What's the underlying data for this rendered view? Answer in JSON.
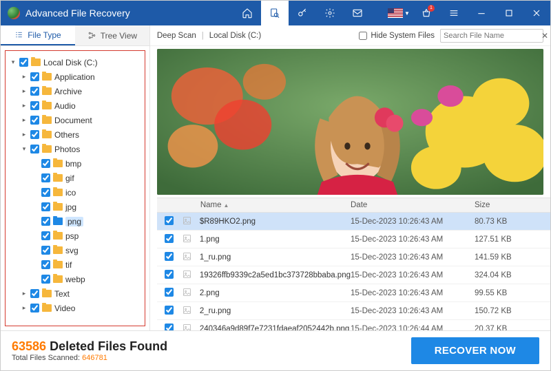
{
  "app": {
    "title": "Advanced File Recovery"
  },
  "titlebar": {
    "badge": "1"
  },
  "sidebar": {
    "tabs": {
      "file_type": "File Type",
      "tree_view": "Tree View"
    },
    "tree": [
      {
        "level": 0,
        "expander": "▾",
        "label": "Local Disk (C:)",
        "selected": false
      },
      {
        "level": 1,
        "expander": "▸",
        "label": "Application",
        "selected": false
      },
      {
        "level": 1,
        "expander": "▸",
        "label": "Archive",
        "selected": false
      },
      {
        "level": 1,
        "expander": "▸",
        "label": "Audio",
        "selected": false
      },
      {
        "level": 1,
        "expander": "▸",
        "label": "Document",
        "selected": false
      },
      {
        "level": 1,
        "expander": "▸",
        "label": "Others",
        "selected": false
      },
      {
        "level": 1,
        "expander": "▾",
        "label": "Photos",
        "selected": false
      },
      {
        "level": 2,
        "expander": "",
        "label": "bmp",
        "selected": false
      },
      {
        "level": 2,
        "expander": "",
        "label": "gif",
        "selected": false
      },
      {
        "level": 2,
        "expander": "",
        "label": "ico",
        "selected": false
      },
      {
        "level": 2,
        "expander": "",
        "label": "jpg",
        "selected": false
      },
      {
        "level": 2,
        "expander": "",
        "label": "png",
        "selected": true
      },
      {
        "level": 2,
        "expander": "",
        "label": "psp",
        "selected": false
      },
      {
        "level": 2,
        "expander": "",
        "label": "svg",
        "selected": false
      },
      {
        "level": 2,
        "expander": "",
        "label": "tif",
        "selected": false
      },
      {
        "level": 2,
        "expander": "",
        "label": "webp",
        "selected": false
      },
      {
        "level": 1,
        "expander": "▸",
        "label": "Text",
        "selected": false
      },
      {
        "level": 1,
        "expander": "▸",
        "label": "Video",
        "selected": false
      }
    ]
  },
  "toolbar": {
    "scan_mode": "Deep Scan",
    "location": "Local Disk (C:)",
    "hide_system": "Hide System Files",
    "search_placeholder": "Search File Name"
  },
  "grid": {
    "headers": {
      "name": "Name",
      "date": "Date",
      "size": "Size"
    },
    "rows": [
      {
        "name": "$R89HKO2.png",
        "date": "15-Dec-2023 10:26:43 AM",
        "size": "80.73 KB",
        "selected": true
      },
      {
        "name": "1.png",
        "date": "15-Dec-2023 10:26:43 AM",
        "size": "127.51 KB",
        "selected": false
      },
      {
        "name": "1_ru.png",
        "date": "15-Dec-2023 10:26:43 AM",
        "size": "141.59 KB",
        "selected": false
      },
      {
        "name": "19326ffb9339c2a5ed1bc373728bbaba.png",
        "date": "15-Dec-2023 10:26:43 AM",
        "size": "324.04 KB",
        "selected": false
      },
      {
        "name": "2.png",
        "date": "15-Dec-2023 10:26:43 AM",
        "size": "99.55 KB",
        "selected": false
      },
      {
        "name": "2_ru.png",
        "date": "15-Dec-2023 10:26:43 AM",
        "size": "150.72 KB",
        "selected": false
      },
      {
        "name": "240346a9d89f7e7231fdaeaf2052442b.png",
        "date": "15-Dec-2023 10:26:44 AM",
        "size": "20.37 KB",
        "selected": false
      }
    ]
  },
  "footer": {
    "deleted_count": "63586",
    "deleted_suffix": " Deleted Files Found",
    "scanned_label": "Total Files Scanned: ",
    "scanned_count": "646781",
    "recover_button": "RECOVER NOW"
  }
}
